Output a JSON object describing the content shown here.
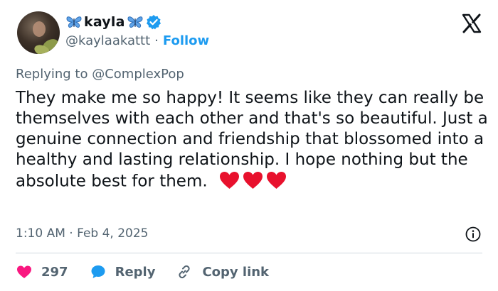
{
  "author": {
    "display_name": "kayla",
    "handle": "@kaylaakattt",
    "follow_label": "Follow",
    "separator": "·",
    "verified": true
  },
  "reply": {
    "prefix": "Replying to",
    "mention": "@ComplexPop"
  },
  "tweet": {
    "text": "They make me so happy! It seems like they can really be themselves with each other and that's so beautiful. Just a genuine connection and friendship that blossomed into a healthy and lasting relationship. I hope nothing but the absolute best for them.",
    "emoji": [
      "red-heart",
      "red-heart",
      "red-heart"
    ],
    "time": "1:10 AM",
    "separator": "·",
    "date": "Feb 4, 2025"
  },
  "actions": {
    "like_count": "297",
    "reply_label": "Reply",
    "copy_link_label": "Copy link"
  },
  "colors": {
    "accent": "#1d9bf0",
    "like": "#f91880",
    "heart_emoji": "#e8112d",
    "muted": "#536471",
    "butterfly": "#4a8fd8"
  },
  "icons": {
    "brand": "x-logo-icon",
    "verified": "verified-badge-icon",
    "butterfly": "butterfly-icon",
    "info": "info-icon",
    "like": "heart-icon",
    "reply": "reply-bubble-icon",
    "copy": "link-icon"
  }
}
